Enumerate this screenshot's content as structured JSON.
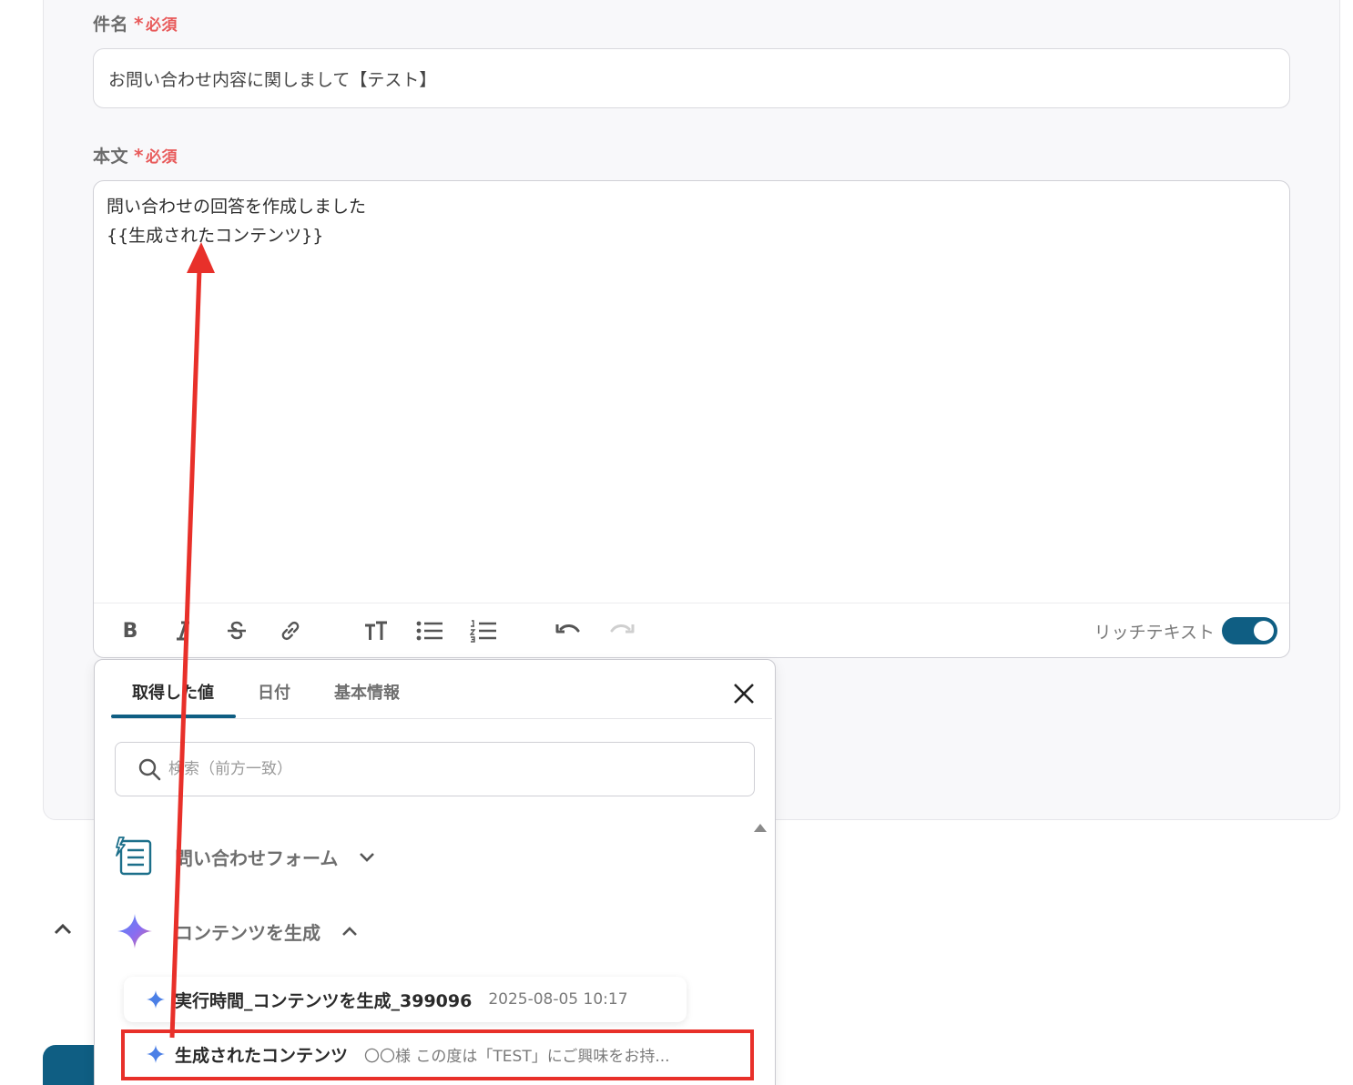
{
  "form": {
    "subject": {
      "label": "件名",
      "required": "必須",
      "value": "お問い合わせ内容に関しまして【テスト】"
    },
    "body": {
      "label": "本文",
      "required": "必須",
      "line1": "問い合わせの回答を作成しました",
      "line2": "{{生成されたコンテンツ}}"
    },
    "toolbar": {
      "bold": "B",
      "rich_text_label": "リッチテキスト",
      "rich_text_on": true
    }
  },
  "picker": {
    "tabs": [
      {
        "label": "取得した値",
        "active": true
      },
      {
        "label": "日付",
        "active": false
      },
      {
        "label": "基本情報",
        "active": false
      }
    ],
    "search_placeholder": "検索（前方一致）",
    "groups": [
      {
        "label": "問い合わせフォーム",
        "expanded": false,
        "icon": "form-icon"
      },
      {
        "label": "コンテンツを生成",
        "expanded": true,
        "icon": "sparkle-icon"
      }
    ],
    "items": [
      {
        "name": "実行時間_コンテンツを生成_399096",
        "meta": "2025-08-05 10:17"
      },
      {
        "name": "生成されたコンテンツ",
        "meta": "〇〇様 この度は「TEST」にご興味をお持..."
      }
    ]
  },
  "colors": {
    "accent": "#0f5e83",
    "required": "#e85a5a",
    "annotation": "#e8302a"
  }
}
